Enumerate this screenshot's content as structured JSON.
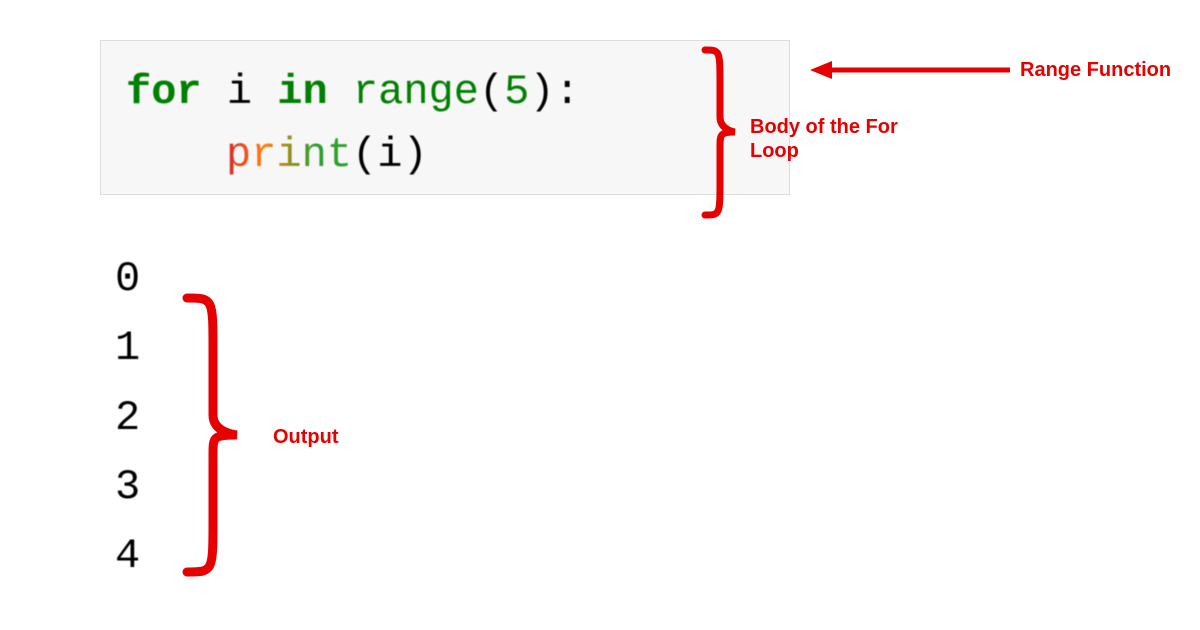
{
  "code": {
    "line1": {
      "for": "for",
      "space1": " ",
      "var": "i",
      "space2": " ",
      "in": "in",
      "space3": " ",
      "range": "range",
      "popen": "(",
      "arg": "5",
      "pclose": ")",
      "colon": ":"
    },
    "line2": {
      "print": "print",
      "popen": "(",
      "arg": "i",
      "pclose": ")"
    }
  },
  "output": [
    "0",
    "1",
    "2",
    "3",
    "4"
  ],
  "annotations": {
    "range_function": "Range Function",
    "body_loop": "Body of the For Loop",
    "output_label": "Output"
  }
}
